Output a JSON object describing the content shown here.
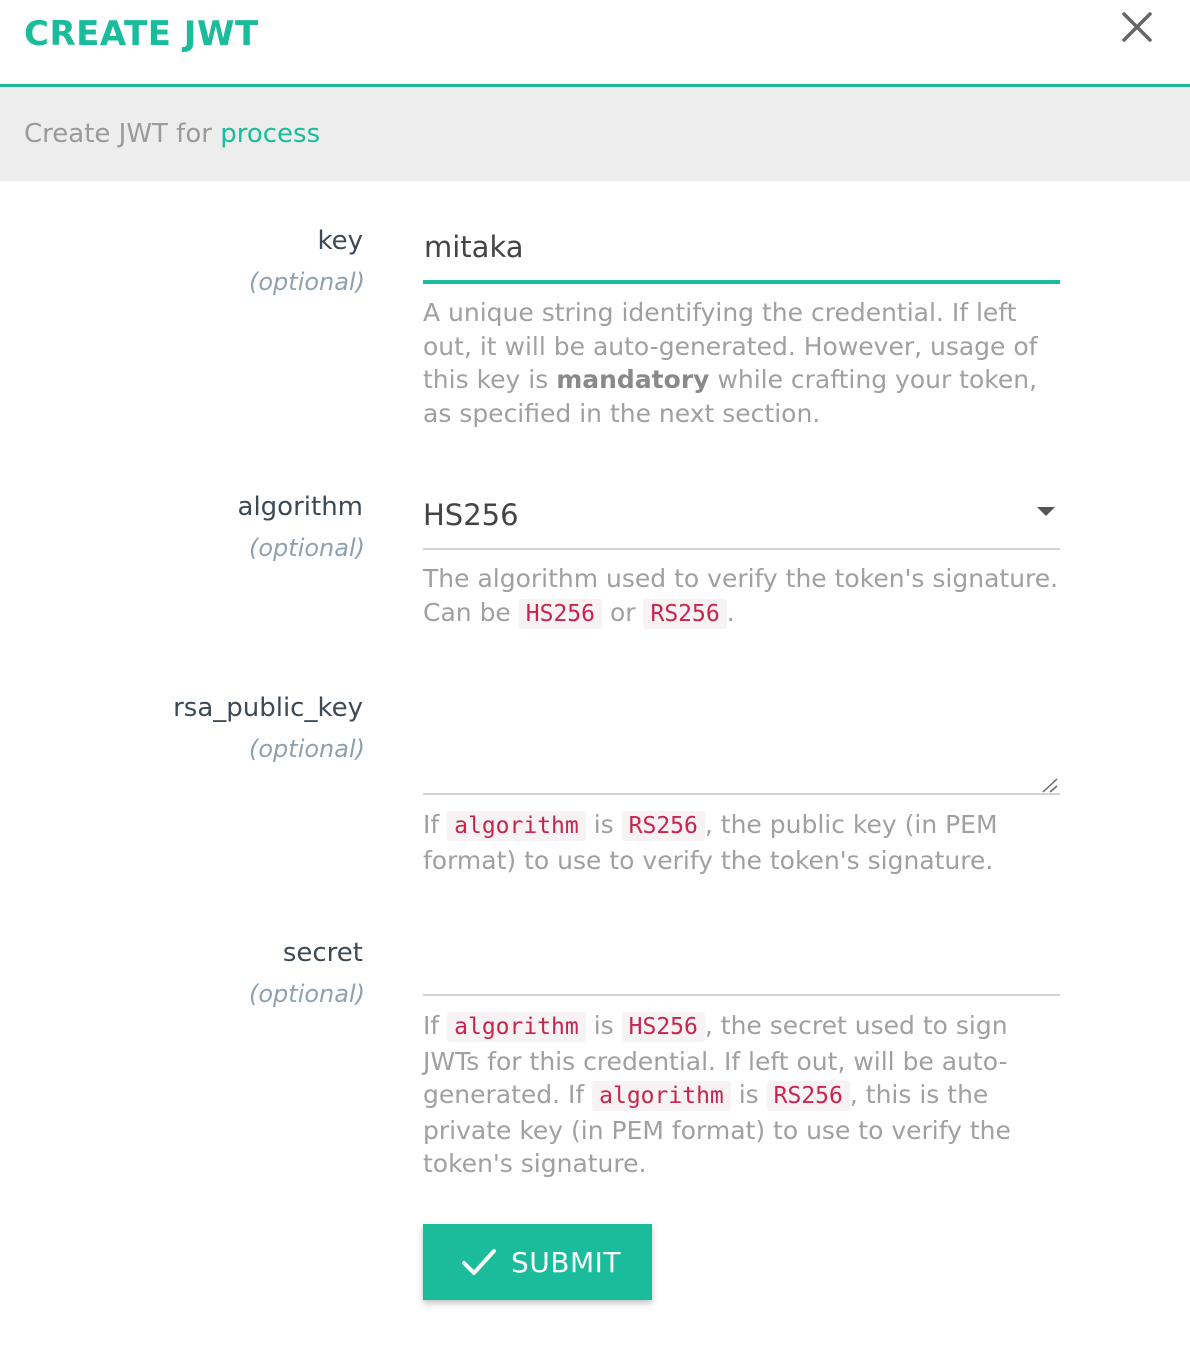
{
  "header": {
    "title": "CREATE JWT"
  },
  "subheader": {
    "prefix": "Create JWT for ",
    "consumer": "process"
  },
  "fields": {
    "key": {
      "label": "key",
      "optional": "(optional)",
      "value": "mitaka",
      "help": {
        "before": "A unique string identifying the credential. If left out, it will be auto-generated. However, usage of this key is ",
        "bold": "mandatory",
        "after": " while crafting your token, as specified in the next section."
      }
    },
    "algorithm": {
      "label": "algorithm",
      "optional": "(optional)",
      "value": "HS256",
      "help": {
        "t1": "The algorithm used to verify the token's signature. Can be ",
        "c1": "HS256",
        "t2": " or ",
        "c2": "RS256",
        "t3": "."
      }
    },
    "rsa_public_key": {
      "label": "rsa_public_key",
      "optional": "(optional)",
      "value": "",
      "help": {
        "t1": "If ",
        "c1": "algorithm",
        "t2": " is ",
        "c2": "RS256",
        "t3": ", the public key (in PEM format) to use to verify the token's signature."
      }
    },
    "secret": {
      "label": "secret",
      "optional": "(optional)",
      "value": "",
      "help": {
        "t1": "If ",
        "c1": "algorithm",
        "t2": " is ",
        "c2": "HS256",
        "t3": ", the secret used to sign JWTs for this credential. If left out, will be auto-generated. If ",
        "c3": "algorithm",
        "t4": " is ",
        "c4": "RS256",
        "t5": ", this is the private key (in PEM format) to use to verify the token's signature."
      }
    }
  },
  "submit": {
    "label": "SUBMIT"
  },
  "colors": {
    "accent": "#1abc9c",
    "code": "#c7254e",
    "muted": "#a0a0a0"
  }
}
